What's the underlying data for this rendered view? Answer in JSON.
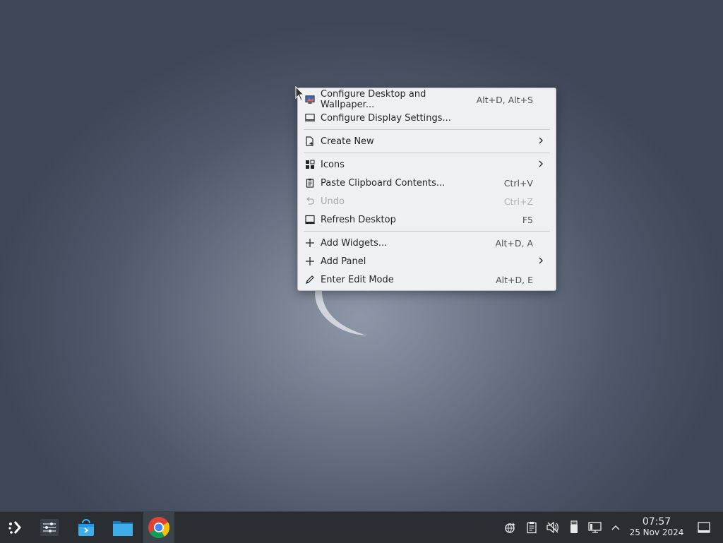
{
  "menu": {
    "items": [
      {
        "label": "Configure Desktop and Wallpaper...",
        "shortcut": "Alt+D, Alt+S",
        "icon": "desktop-wallpaper-icon"
      },
      {
        "label": "Configure Display Settings...",
        "shortcut": "",
        "icon": "display-icon"
      },
      {
        "label": "Create New",
        "shortcut": "",
        "icon": "create-new-icon",
        "submenu": true
      },
      {
        "label": "Icons",
        "shortcut": "",
        "icon": "icons-grid-icon",
        "submenu": true
      },
      {
        "label": "Paste Clipboard Contents...",
        "shortcut": "Ctrl+V",
        "icon": "clipboard-icon"
      },
      {
        "label": "Undo",
        "shortcut": "Ctrl+Z",
        "icon": "undo-icon",
        "disabled": true
      },
      {
        "label": "Refresh Desktop",
        "shortcut": "F5",
        "icon": "refresh-desktop-icon"
      },
      {
        "label": "Add Widgets...",
        "shortcut": "Alt+D, A",
        "icon": "plus-icon"
      },
      {
        "label": "Add Panel",
        "shortcut": "",
        "icon": "plus-icon",
        "submenu": true
      },
      {
        "label": "Enter Edit Mode",
        "shortcut": "Alt+D, E",
        "icon": "pencil-icon"
      }
    ]
  },
  "taskbar": {
    "apps": [
      "application-launcher-icon",
      "system-settings-icon",
      "discover-store-icon",
      "file-manager-icon",
      "chrome-icon"
    ],
    "tray": [
      "network-icon",
      "clipboard-icon",
      "volume-muted-icon",
      "usb-device-icon",
      "display-config-icon",
      "expand-tray-icon"
    ],
    "clock": {
      "time": "07:57",
      "date": "25 Nov 2024"
    }
  },
  "colors": {
    "menu_bg": "#eff0f1",
    "taskbar_bg": "#2a2e33",
    "accent": "#3daee9"
  }
}
